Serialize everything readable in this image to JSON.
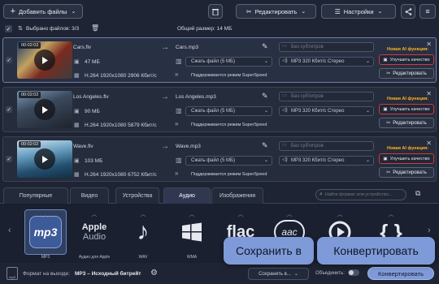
{
  "toolbar": {
    "add_files": "Добавить файлы",
    "edit": "Редактировать",
    "settings": "Настройки"
  },
  "list_header": {
    "selected": "Выбрано файлов: 3/3",
    "total_size": "Общий размер: 14 МБ"
  },
  "files": [
    {
      "duration": "00:02:02",
      "name": "Cars.flv",
      "size": "47 МБ",
      "codec": "H.264 1920x1080 2906 Кбит/с",
      "output": "Cars.mp3",
      "compress": "Сжать файл (5 МБ)",
      "subtitles": "Без субтитров",
      "audio": "MP3 320 Кбит/с Стерео",
      "superspeed": "Поддерживается режим SuperSpeed",
      "ai_label": "Новая AI функция:",
      "improve": "Улучшить качество",
      "edit": "Редактировать"
    },
    {
      "duration": "00:02:02",
      "name": "Los Angeles.flv",
      "size": "90 МБ",
      "codec": "H.264 1920x1080 5879 Кбит/с",
      "output": "Los Angeles.mp3",
      "compress": "Сжать файл (5 МБ)",
      "subtitles": "Без субтитров",
      "audio": "MP3 320 Кбит/с Стерео",
      "superspeed": "Поддерживается режим SuperSpeed",
      "ai_label": "Новая AI функция:",
      "improve": "Улучшить качество",
      "edit": "Редактировать"
    },
    {
      "duration": "00:02:02",
      "name": "Wave.flv",
      "size": "103 МБ",
      "codec": "H.264 1920x1080 6752 Кбит/с",
      "output": "Wave.mp3",
      "compress": "Сжать файл (5 МБ)",
      "subtitles": "Без субтитров",
      "audio": "MP3 320 Кбит/с Стерео",
      "superspeed": "Поддерживается режим SuperSpeed",
      "ai_label": "Новая AI функция:",
      "improve": "Улучшить качество",
      "edit": "Редактировать"
    }
  ],
  "tabs": [
    "Популярные",
    "Видео",
    "Устройства",
    "Аудио",
    "Изображения"
  ],
  "active_tab": "Аудио",
  "format_search_placeholder": "Найти формат или устройство...",
  "formats": [
    {
      "icon": "mp3",
      "label": "MP3"
    },
    {
      "icon": "Apple Audio",
      "label": "Аудио для Apple"
    },
    {
      "icon": "note",
      "label": "WAV"
    },
    {
      "icon": "windows",
      "label": "WMA"
    },
    {
      "icon": "flac",
      "label": ""
    },
    {
      "icon": "aac",
      "label": ""
    },
    {
      "icon": "ogg",
      "label": ""
    },
    {
      "icon": "braces",
      "label": ""
    }
  ],
  "footer": {
    "output_label": "Формат на выходе:",
    "output_value": "MP3 – Исходный битрейт",
    "save_to": "Сохранить в...",
    "merge": "Объединить:",
    "convert": "Конвертировать"
  },
  "tooltips": {
    "save_in": "Сохранить в",
    "convert": "Конвертировать"
  },
  "colors": {
    "accent": "#7f9ad8",
    "ai_label": "#ffb21f",
    "improve_border": "#d23b3b"
  }
}
